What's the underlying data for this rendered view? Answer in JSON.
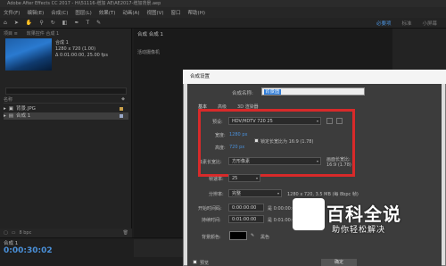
{
  "titlebar": {
    "title": "Adobe After Effects CC 2017 - Hi\\51116-增加 AE\\AE2017-增加背景.aep"
  },
  "menu": [
    "文件(F)",
    "编辑(E)",
    "合成(C)",
    "图层(L)",
    "效果(T)",
    "动画(A)",
    "视图(V)",
    "窗口",
    "帮助(H)"
  ],
  "workspaces": {
    "active": "必要项",
    "items": [
      "标准",
      "小屏幕"
    ]
  },
  "project": {
    "tabs": [
      "项目 ≡",
      "效果控件 合成 1"
    ],
    "comp_name": "合成 1",
    "comp_res": "1280 x 720 (1.00)",
    "comp_dur": "Δ 0:01:00:00, 25.00 fps",
    "list_header_name": "名称",
    "items": [
      {
        "name": "背景.JPG",
        "color": "#c9a04b"
      },
      {
        "name": "合成 1",
        "color": "#9aa8c8"
      }
    ],
    "bpc": "8 bpc"
  },
  "viewer": {
    "tab": "合成 合成 1",
    "sub": "活动摄像机"
  },
  "timeline": {
    "tab": "合成 1",
    "time": "0:00:30:02"
  },
  "dialog": {
    "title": "合成设置",
    "name_label": "合成名称:",
    "name_value": "背景图",
    "tabs": [
      "基本",
      "高级",
      "3D 渲染器"
    ],
    "preset_label": "预设:",
    "preset_value": "HDV/HDTV 720 25",
    "width_label": "宽度:",
    "width_value": "1280 px",
    "height_label": "高度:",
    "height_value": "720 px",
    "lock_label": "锁定长宽比为 16:9 (1.78)",
    "pixel_aspect_label": "像素长宽比:",
    "pixel_aspect_value": "方形像素",
    "frame_aspect_label": "画面长宽比:",
    "frame_aspect_value": "16:9 (1.78)",
    "frame_rate_label": "帧速率:",
    "frame_rate_value": "25",
    "resolution_label": "分辨率:",
    "resolution_value": "完整",
    "resolution_info": "1280 x 720, 3.5 MB (每 8bpc 帧)",
    "start_tc_label": "开始时间码:",
    "start_tc_value": "0:00:00:00",
    "start_tc_info": "是 0:00:00:00  基础 25",
    "duration_label": "持续时间:",
    "duration_value": "0:01:00:00",
    "duration_info": "是 0:01:00:00  基础 25",
    "bg_label": "背景颜色:",
    "bg_color_name": "黑色",
    "preview_label": "预览",
    "ok_label": "确定"
  },
  "watermark": {
    "text": "百科全说",
    "sub": "助你轻松解决"
  }
}
